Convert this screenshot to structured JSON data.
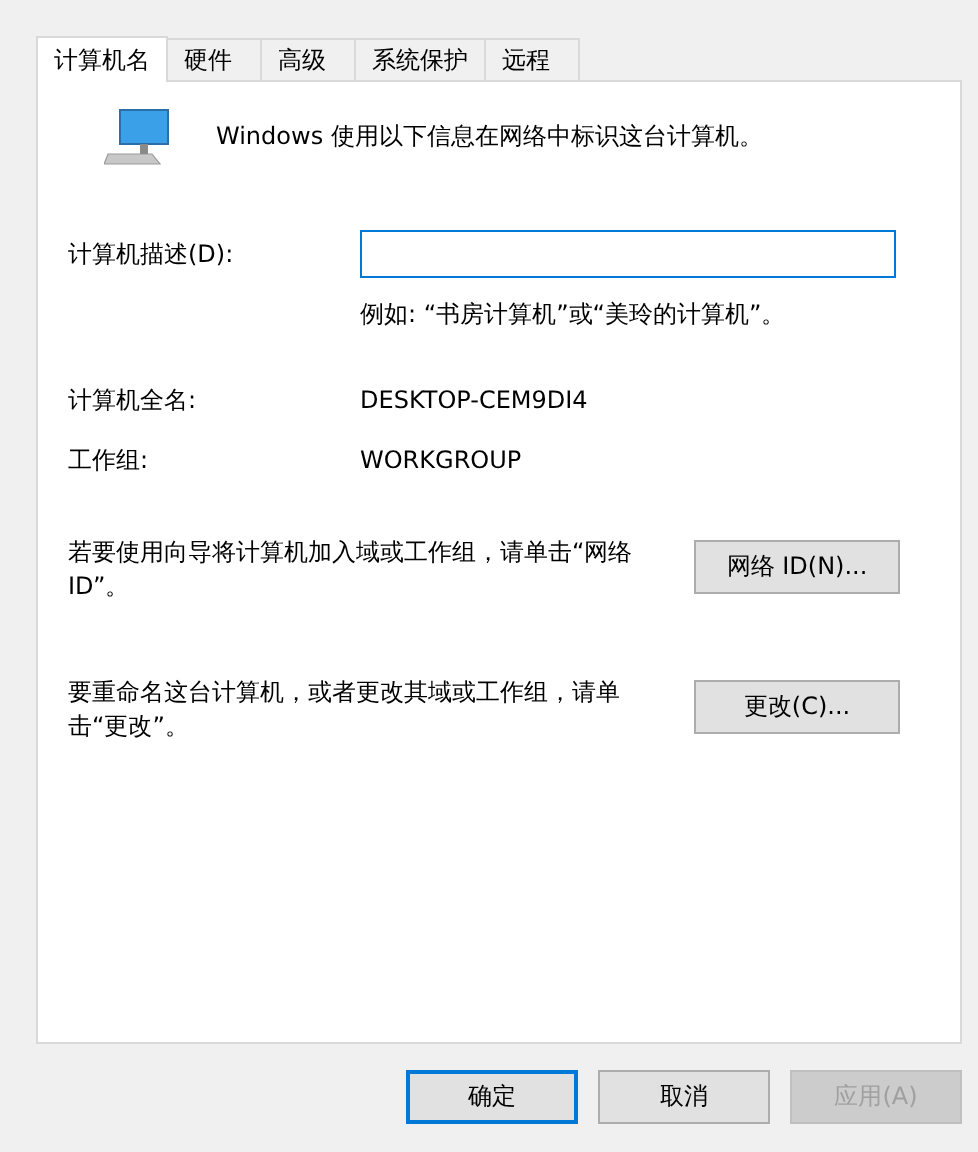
{
  "tabs": [
    {
      "label": "计算机名",
      "selected": true
    },
    {
      "label": "硬件",
      "selected": false
    },
    {
      "label": "高级",
      "selected": false
    },
    {
      "label": "系统保护",
      "selected": false
    },
    {
      "label": "远程",
      "selected": false
    }
  ],
  "intro": "Windows 使用以下信息在网络中标识这台计算机。",
  "description": {
    "label": "计算机描述(D):",
    "hint": "例如: “书房计算机”或“美玲的计算机”。"
  },
  "info": [
    {
      "label": "计算机全名:",
      "value": "DESKTOP-CEM9DI4"
    },
    {
      "label": "工作组:",
      "value": "WORKGROUP"
    }
  ],
  "actions": [
    {
      "text": "若要使用向导将计算机加入域或工作组，请单击“网络 ID”。",
      "button": "网络 ID(N)..."
    },
    {
      "text": "要重命名这台计算机，或者更改其域或工作组，请单击“更改”。",
      "button": "更改(C)..."
    }
  ],
  "buttons": [
    {
      "label": "确定",
      "kind": "default",
      "disabled": false
    },
    {
      "label": "取消",
      "kind": "normal",
      "disabled": false
    },
    {
      "label": "应用(A)",
      "kind": "normal",
      "disabled": true
    }
  ]
}
